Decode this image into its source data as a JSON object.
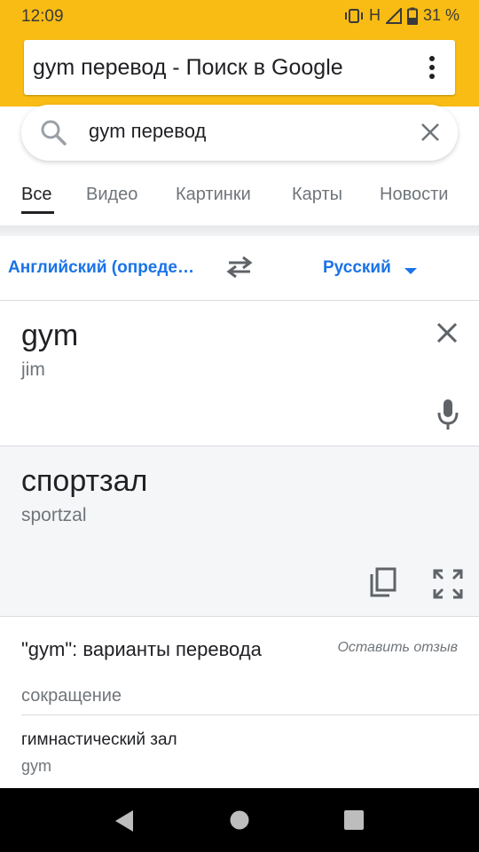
{
  "status_bar": {
    "time": "12:09",
    "network": "H",
    "battery": "31 %"
  },
  "browser": {
    "url_title": "gym перевод - Поиск в Google"
  },
  "search": {
    "query": "gym перевод"
  },
  "tabs": [
    {
      "label": "Все",
      "active": true
    },
    {
      "label": "Видео"
    },
    {
      "label": "Картинки"
    },
    {
      "label": "Карты"
    },
    {
      "label": "Новости"
    }
  ],
  "translator": {
    "source_language": "Английский (опреде…",
    "target_language": "Русский",
    "source_text": "gym",
    "source_transliteration": "jim",
    "translation": "спортзал",
    "translation_transliteration": "sportzal"
  },
  "variants": {
    "title": "\"gym\": варианты перевода",
    "feedback": "Оставить отзыв",
    "part_of_speech": "сокращение",
    "items": [
      {
        "term": "гимнастический зал",
        "back_translation": "gym"
      }
    ]
  },
  "colors": {
    "accent_yellow": "#f8bc14",
    "link_blue": "#1a73e8"
  }
}
